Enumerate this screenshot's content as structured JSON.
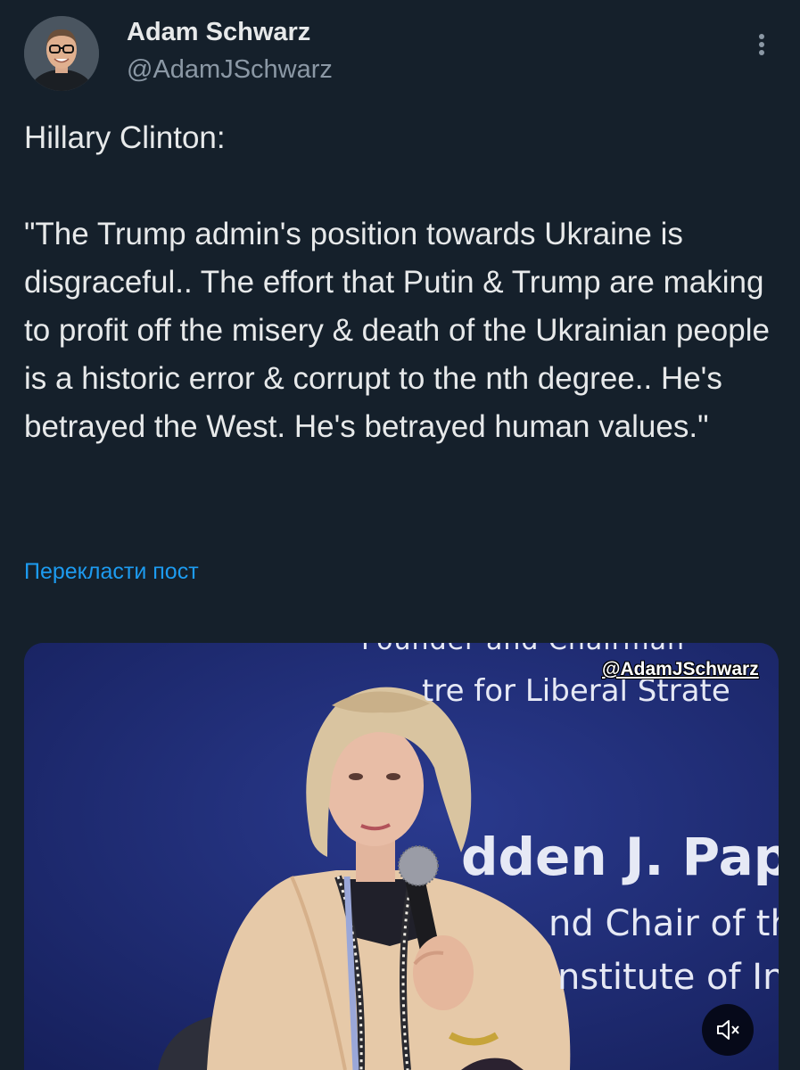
{
  "author": {
    "display_name": "Adam Schwarz",
    "handle": "@AdamJSchwarz"
  },
  "tweet": {
    "text": "Hillary Clinton:\n\n\"The Trump admin's position towards Ukraine is disgraceful.. The effort that Putin & Trump are making to profit off the misery & death of the Ukrainian people is a historic error & corrupt to the nth degree.. He's betrayed the West. He's betrayed human values.\"",
    "translate_label": "Перекласти пост"
  },
  "media": {
    "watermark": "@AdamJSchwarz",
    "backdrop_lines": [
      "Founder and Chairman",
      "tre for Liberal Strate",
      "dden J. Pap",
      "nd Chair of th",
      "nstitute of In"
    ],
    "mute_icon": "speaker-muted-icon"
  },
  "colors": {
    "background": "#15202b",
    "text": "#e7e9ea",
    "muted_text": "#8b98a5",
    "link": "#1d9bf0",
    "backdrop": "#1c2a73"
  }
}
